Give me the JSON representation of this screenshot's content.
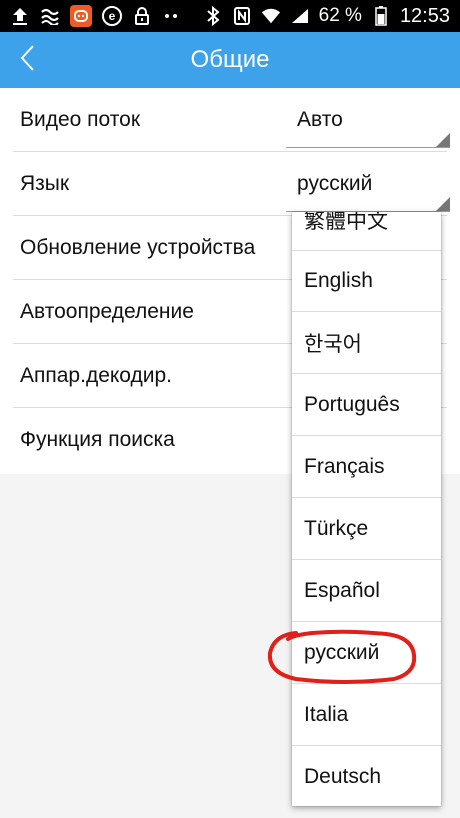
{
  "status_bar": {
    "battery": "62 %",
    "time": "12:53",
    "icons": [
      "upload-icon",
      "sync-icon",
      "app-notification-icon",
      "e-icon",
      "lock-icon",
      "more-icon",
      "bluetooth-icon",
      "nfc-icon",
      "wifi-icon",
      "signal-icon",
      "battery-icon"
    ]
  },
  "header": {
    "title": "Общие",
    "back_icon": "chevron-left-icon",
    "color": "#3ea2ea"
  },
  "settings": {
    "rows": [
      {
        "label": "Видео поток",
        "value": "Авто"
      },
      {
        "label": "Язык",
        "value": "русский"
      },
      {
        "label": "Обновление устройства"
      },
      {
        "label": "Автоопределение"
      },
      {
        "label": "Аппар.декодир."
      },
      {
        "label": "Функция поиска"
      }
    ]
  },
  "language_dropdown": {
    "options": [
      "繁體中文",
      "English",
      "한국어",
      "Português",
      "Français",
      "Türkçe",
      "Español",
      "русский",
      "Italia",
      "Deutsch"
    ],
    "selected": "русский",
    "highlight_color": "#e0201b"
  }
}
